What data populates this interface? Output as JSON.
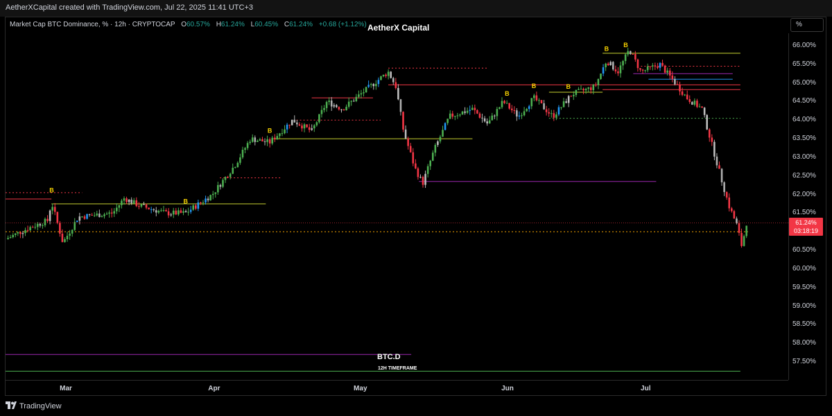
{
  "header": {
    "byline": "AetherXCapital created with TradingView.com, Jul 22, 2025 11:41 UTC+3"
  },
  "legend": {
    "instrument": "Market Cap BTC Dominance, % · 12h · CRYPTOCAP",
    "o_label": "O",
    "o_value": "60.57%",
    "h_label": "H",
    "h_value": "61.24%",
    "l_label": "L",
    "l_value": "60.45%",
    "c_label": "C",
    "c_value": "61.24%",
    "change": "+0.68 (+1.12%)"
  },
  "watermark_title": "AetherX Capital",
  "unit_button": "%",
  "price_tag": {
    "price": "61.24%",
    "countdown": "03:18:19"
  },
  "symbol_label": "BTC.D",
  "timeframe_label": "12H TIMEFRAME",
  "footer_brand": "TradingView",
  "colors": {
    "up": "#4caf50",
    "down": "#f23645",
    "accent": "#f7a600",
    "level_purple": "#9c27b0"
  },
  "chart_data": {
    "type": "candlestick",
    "symbol": "BTC.D",
    "y_ticks": [
      "66.00%",
      "65.50%",
      "65.00%",
      "64.50%",
      "64.00%",
      "63.50%",
      "63.00%",
      "62.50%",
      "62.00%",
      "61.50%",
      "61.00%",
      "60.50%",
      "60.00%",
      "59.50%",
      "59.00%",
      "58.50%",
      "58.00%",
      "57.50%"
    ],
    "ylim": [
      57.2,
      66.2
    ],
    "x_ticks": [
      "Mar",
      "Apr",
      "May",
      "Jun",
      "Jul"
    ],
    "last_price": 61.24,
    "close_path": [
      {
        "t": 0,
        "v": 60.8
      },
      {
        "t": 0.03,
        "v": 61.1
      },
      {
        "t": 0.055,
        "v": 61.3
      },
      {
        "t": 0.06,
        "v": 61.8
      },
      {
        "t": 0.075,
        "v": 60.7
      },
      {
        "t": 0.095,
        "v": 61.4
      },
      {
        "t": 0.14,
        "v": 61.5
      },
      {
        "t": 0.155,
        "v": 61.9
      },
      {
        "t": 0.175,
        "v": 61.7
      },
      {
        "t": 0.21,
        "v": 61.5
      },
      {
        "t": 0.235,
        "v": 61.5
      },
      {
        "t": 0.27,
        "v": 62.0
      },
      {
        "t": 0.3,
        "v": 62.8
      },
      {
        "t": 0.32,
        "v": 63.5
      },
      {
        "t": 0.345,
        "v": 63.4
      },
      {
        "t": 0.375,
        "v": 64.0
      },
      {
        "t": 0.4,
        "v": 63.7
      },
      {
        "t": 0.42,
        "v": 64.5
      },
      {
        "t": 0.44,
        "v": 64.3
      },
      {
        "t": 0.47,
        "v": 64.8
      },
      {
        "t": 0.5,
        "v": 65.3
      },
      {
        "t": 0.51,
        "v": 64.9
      },
      {
        "t": 0.52,
        "v": 63.7
      },
      {
        "t": 0.535,
        "v": 62.7
      },
      {
        "t": 0.545,
        "v": 62.3
      },
      {
        "t": 0.56,
        "v": 63.2
      },
      {
        "t": 0.58,
        "v": 64.1
      },
      {
        "t": 0.61,
        "v": 64.3
      },
      {
        "t": 0.63,
        "v": 63.9
      },
      {
        "t": 0.65,
        "v": 64.5
      },
      {
        "t": 0.67,
        "v": 64.1
      },
      {
        "t": 0.69,
        "v": 64.6
      },
      {
        "t": 0.715,
        "v": 64.1
      },
      {
        "t": 0.74,
        "v": 64.7
      },
      {
        "t": 0.77,
        "v": 64.9
      },
      {
        "t": 0.785,
        "v": 65.6
      },
      {
        "t": 0.8,
        "v": 65.3
      },
      {
        "t": 0.815,
        "v": 65.9
      },
      {
        "t": 0.83,
        "v": 65.3
      },
      {
        "t": 0.855,
        "v": 65.5
      },
      {
        "t": 0.875,
        "v": 65.0
      },
      {
        "t": 0.89,
        "v": 64.6
      },
      {
        "t": 0.91,
        "v": 64.3
      },
      {
        "t": 0.93,
        "v": 62.8
      },
      {
        "t": 0.945,
        "v": 61.7
      },
      {
        "t": 0.955,
        "v": 61.2
      },
      {
        "t": 0.962,
        "v": 60.6
      },
      {
        "t": 0.968,
        "v": 61.24
      }
    ],
    "levels": [
      {
        "y": 61.0,
        "from": 0.0,
        "to": 0.97,
        "color": "#f7a600",
        "style": "dotted"
      },
      {
        "y": 61.75,
        "from": 0.06,
        "to": 0.34,
        "color": "#c8d230",
        "style": "solid"
      },
      {
        "y": 62.05,
        "from": 0.0,
        "to": 0.1,
        "color": "#f23645",
        "style": "dotted"
      },
      {
        "y": 61.88,
        "from": 0.0,
        "to": 0.06,
        "color": "#f23645",
        "style": "solid"
      },
      {
        "y": 62.35,
        "from": 0.54,
        "to": 0.85,
        "color": "#9c27b0",
        "style": "solid"
      },
      {
        "y": 62.45,
        "from": 0.28,
        "to": 0.36,
        "color": "#f23645",
        "style": "dotted"
      },
      {
        "y": 63.5,
        "from": 0.35,
        "to": 0.61,
        "color": "#c8d230",
        "style": "solid"
      },
      {
        "y": 64.0,
        "from": 0.38,
        "to": 0.49,
        "color": "#f23645",
        "style": "dotted"
      },
      {
        "y": 64.05,
        "from": 0.71,
        "to": 0.96,
        "color": "#4caf50",
        "style": "dotted"
      },
      {
        "y": 64.6,
        "from": 0.4,
        "to": 0.48,
        "color": "#f23645",
        "style": "solid"
      },
      {
        "y": 65.4,
        "from": 0.5,
        "to": 0.63,
        "color": "#f23645",
        "style": "dotted"
      },
      {
        "y": 64.95,
        "from": 0.5,
        "to": 0.96,
        "color": "#f23645",
        "style": "solid"
      },
      {
        "y": 64.75,
        "from": 0.71,
        "to": 0.78,
        "color": "#c8d230",
        "style": "solid"
      },
      {
        "y": 64.82,
        "from": 0.78,
        "to": 0.96,
        "color": "#f23645",
        "style": "solid"
      },
      {
        "y": 65.8,
        "from": 0.78,
        "to": 0.96,
        "color": "#c8d230",
        "style": "solid"
      },
      {
        "y": 65.45,
        "from": 0.83,
        "to": 0.96,
        "color": "#f23645",
        "style": "dotted"
      },
      {
        "y": 65.25,
        "from": 0.82,
        "to": 0.95,
        "color": "#9c27b0",
        "style": "solid"
      },
      {
        "y": 65.1,
        "from": 0.84,
        "to": 0.95,
        "color": "#2196f3",
        "style": "solid"
      },
      {
        "y": 57.7,
        "from": 0.0,
        "to": 0.53,
        "color": "#9c27b0",
        "style": "solid"
      },
      {
        "y": 57.25,
        "from": 0.0,
        "to": 0.96,
        "color": "#4caf50",
        "style": "solid"
      }
    ],
    "markers": [
      {
        "t": 0.06,
        "label": "B"
      },
      {
        "t": 0.235,
        "label": "B"
      },
      {
        "t": 0.345,
        "label": "B"
      },
      {
        "t": 0.655,
        "label": "B"
      },
      {
        "t": 0.69,
        "label": "B"
      },
      {
        "t": 0.735,
        "label": "B"
      },
      {
        "t": 0.785,
        "label": "B"
      },
      {
        "t": 0.81,
        "label": "B"
      }
    ]
  }
}
